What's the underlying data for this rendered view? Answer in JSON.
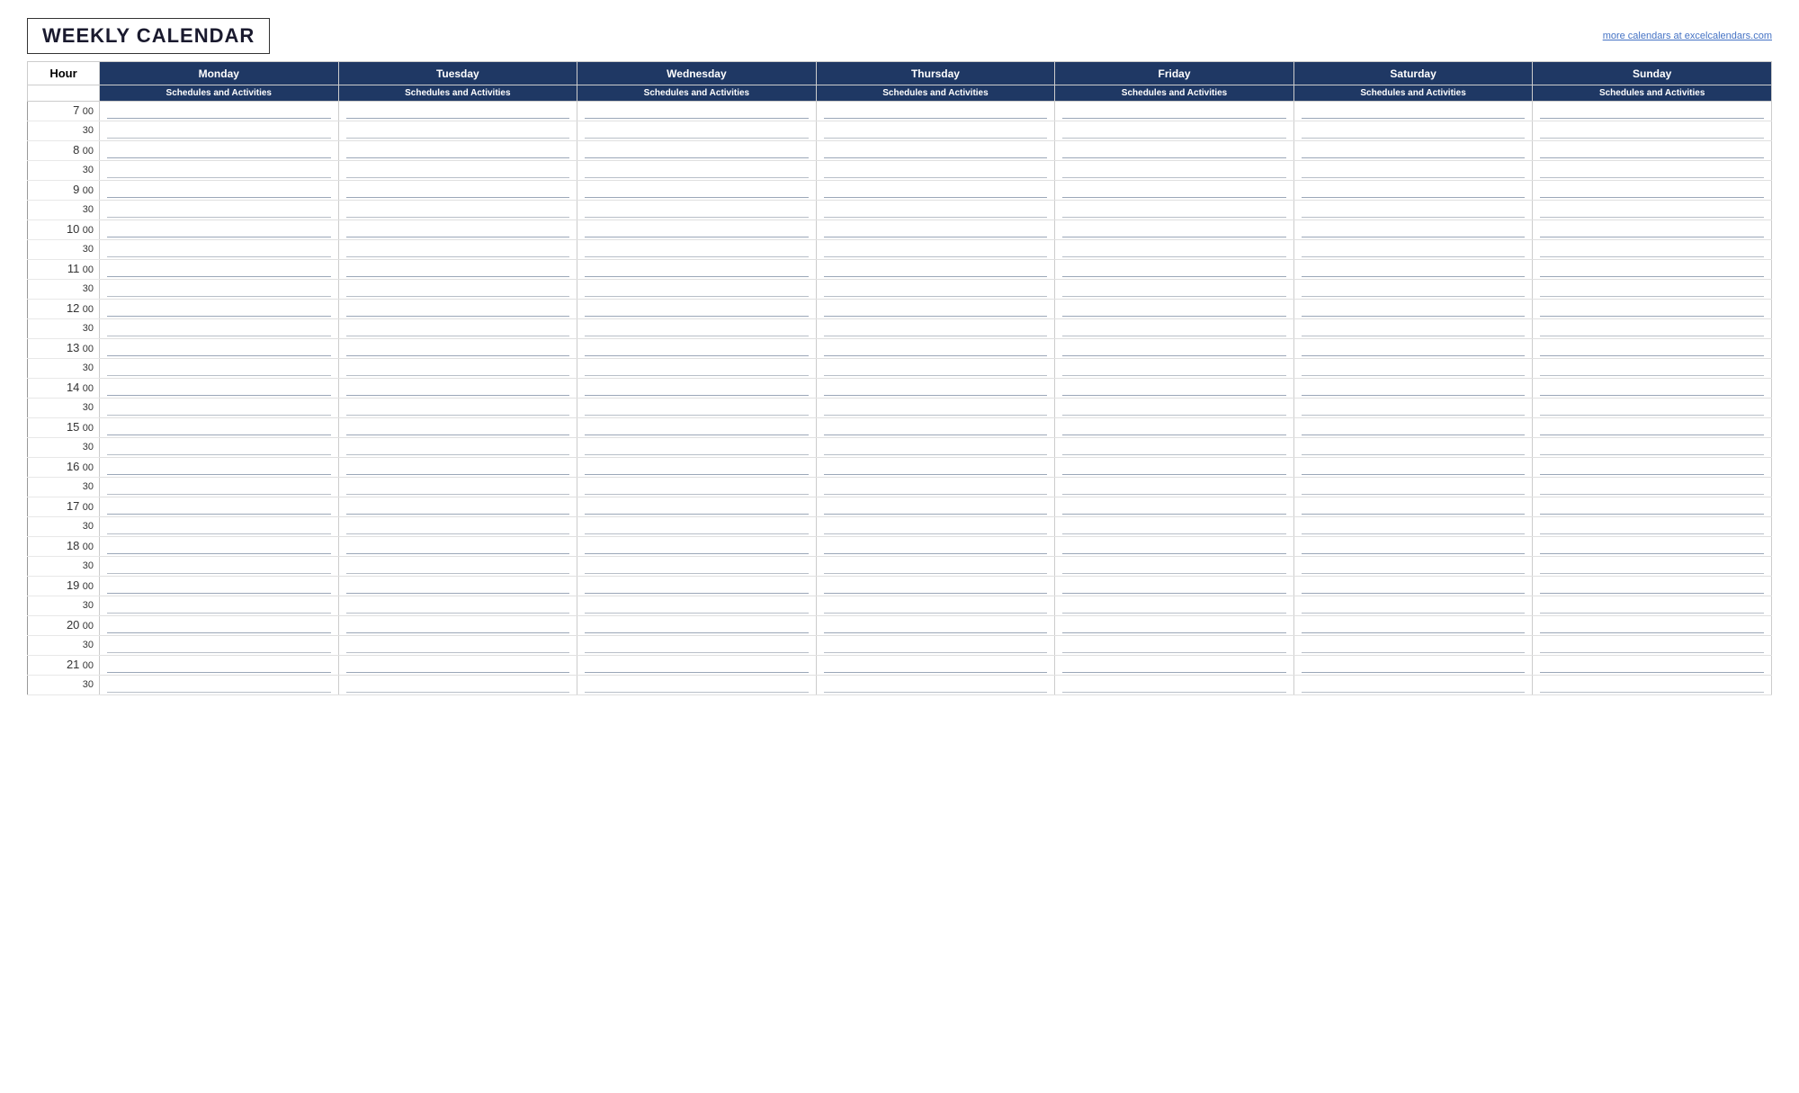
{
  "header": {
    "title": "WEEKLY CALENDAR",
    "external_link": "more calendars at excelcalendars.com"
  },
  "table": {
    "hour_label": "Hour",
    "days": [
      "Monday",
      "Tuesday",
      "Wednesday",
      "Thursday",
      "Friday",
      "Saturday",
      "Sunday"
    ],
    "subheader": "Schedules and Activities",
    "time_slots": [
      {
        "hour": "7",
        "min": "00",
        "is_half": false
      },
      {
        "hour": "",
        "min": "30",
        "is_half": true
      },
      {
        "hour": "8",
        "min": "00",
        "is_half": false
      },
      {
        "hour": "",
        "min": "30",
        "is_half": true
      },
      {
        "hour": "9",
        "min": "00",
        "is_half": false
      },
      {
        "hour": "",
        "min": "30",
        "is_half": true
      },
      {
        "hour": "10",
        "min": "00",
        "is_half": false
      },
      {
        "hour": "",
        "min": "30",
        "is_half": true
      },
      {
        "hour": "11",
        "min": "00",
        "is_half": false
      },
      {
        "hour": "",
        "min": "30",
        "is_half": true
      },
      {
        "hour": "12",
        "min": "00",
        "is_half": false
      },
      {
        "hour": "",
        "min": "30",
        "is_half": true
      },
      {
        "hour": "13",
        "min": "00",
        "is_half": false
      },
      {
        "hour": "",
        "min": "30",
        "is_half": true
      },
      {
        "hour": "14",
        "min": "00",
        "is_half": false
      },
      {
        "hour": "",
        "min": "30",
        "is_half": true
      },
      {
        "hour": "15",
        "min": "00",
        "is_half": false
      },
      {
        "hour": "",
        "min": "30",
        "is_half": true
      },
      {
        "hour": "16",
        "min": "00",
        "is_half": false
      },
      {
        "hour": "",
        "min": "30",
        "is_half": true
      },
      {
        "hour": "17",
        "min": "00",
        "is_half": false
      },
      {
        "hour": "",
        "min": "30",
        "is_half": true
      },
      {
        "hour": "18",
        "min": "00",
        "is_half": false
      },
      {
        "hour": "",
        "min": "30",
        "is_half": true
      },
      {
        "hour": "19",
        "min": "00",
        "is_half": false
      },
      {
        "hour": "",
        "min": "30",
        "is_half": true
      },
      {
        "hour": "20",
        "min": "00",
        "is_half": false
      },
      {
        "hour": "",
        "min": "30",
        "is_half": true
      },
      {
        "hour": "21",
        "min": "00",
        "is_half": false
      },
      {
        "hour": "",
        "min": "30",
        "is_half": true
      }
    ]
  }
}
